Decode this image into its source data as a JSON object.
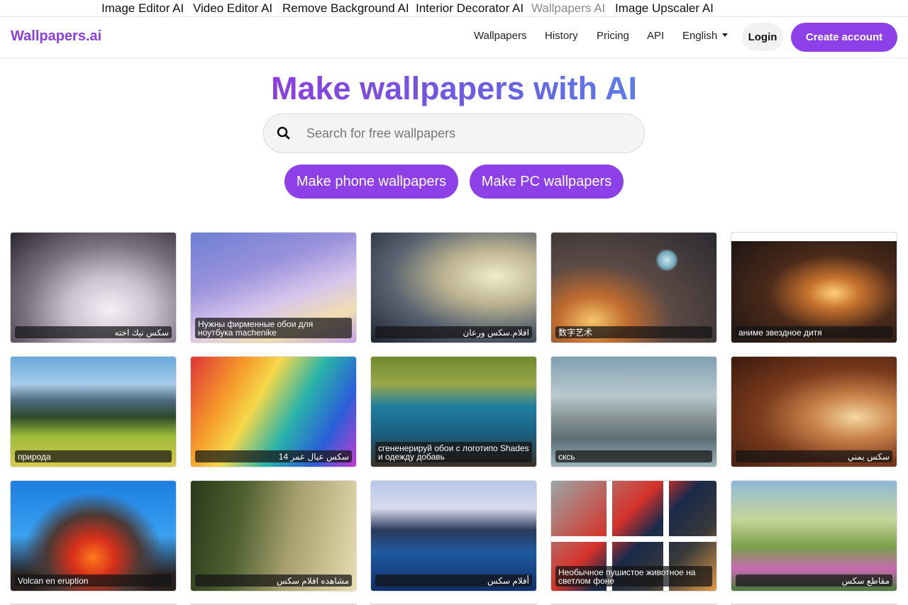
{
  "top_links": [
    {
      "label": "Image Editor AI",
      "active": false
    },
    {
      "label": "Video Editor AI",
      "active": false
    },
    {
      "label": "Remove Background AI",
      "active": false
    },
    {
      "label": "Interior Decorator AI",
      "active": false
    },
    {
      "label": "Wallpapers AI",
      "active": true
    },
    {
      "label": "Image Upscaler AI",
      "active": false
    }
  ],
  "navbar": {
    "brand": "Wallpapers.ai",
    "links": [
      "Wallpapers",
      "History",
      "Pricing",
      "API"
    ],
    "language": "English",
    "login": "Login",
    "create_account": "Create account"
  },
  "hero": {
    "title": "Make wallpapers with AI",
    "search_placeholder": "Search for free wallpapers",
    "phone_button": "Make phone wallpapers",
    "pc_button": "Make PC wallpapers"
  },
  "colors": {
    "brand_purple": "#8b3fe0",
    "button_purple": "#8d3fe8"
  },
  "wallpapers": [
    {
      "caption": "سكس نيك اخته"
    },
    {
      "caption": "Нужны фирменные обои для ноутбука machenike"
    },
    {
      "caption": "افلام.سكس ورعان"
    },
    {
      "caption": "数字艺术"
    },
    {
      "caption": "аниме звездное дитя"
    },
    {
      "caption": "природа"
    },
    {
      "caption": "سكس عيال عمر 14"
    },
    {
      "caption": "сгененерируй обои с логотипо Shades и одежду добавь"
    },
    {
      "caption": "сксь"
    },
    {
      "caption": "سكس يمني"
    },
    {
      "caption": "Volcan en eruption"
    },
    {
      "caption": "مشاهده افلام سكس"
    },
    {
      "caption": "أفلام سكس"
    },
    {
      "caption": "Необычное пушистое животное на светлом фоне"
    },
    {
      "caption": "مقاطع سكس"
    }
  ]
}
